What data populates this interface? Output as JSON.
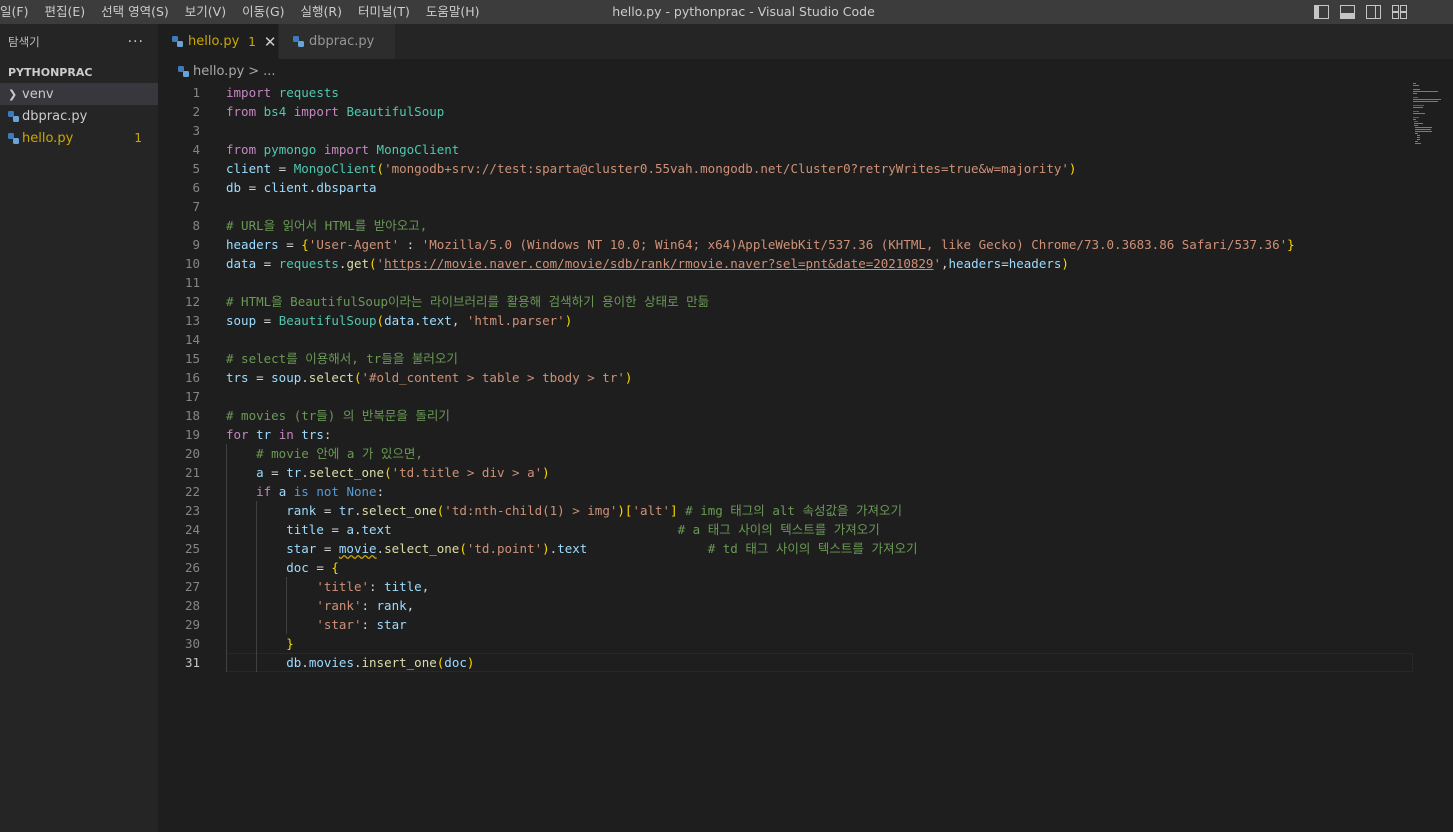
{
  "menu": [
    "일(F)",
    "편집(E)",
    "선택 영역(S)",
    "보기(V)",
    "이동(G)",
    "실행(R)",
    "터미널(T)",
    "도움말(H)"
  ],
  "window_title": "hello.py - pythonprac - Visual Studio Code",
  "sidebar": {
    "title": "탐색기",
    "more": "···",
    "section": "PYTHONPRAC",
    "items": [
      {
        "label": "venv",
        "type": "folder"
      },
      {
        "label": "dbprac.py",
        "type": "file"
      },
      {
        "label": "hello.py",
        "type": "file",
        "badge": "1"
      }
    ]
  },
  "tabs": [
    {
      "label": "hello.py",
      "modified": "1",
      "close": "✕"
    },
    {
      "label": "dbprac.py"
    }
  ],
  "breadcrumb": {
    "file": "hello.py",
    "sep": ">",
    "rest": "..."
  },
  "editor": {
    "line_numbers": [
      "1",
      "2",
      "3",
      "4",
      "5",
      "6",
      "7",
      "8",
      "9",
      "10",
      "11",
      "12",
      "13",
      "14",
      "15",
      "16",
      "17",
      "18",
      "19",
      "20",
      "21",
      "22",
      "23",
      "24",
      "25",
      "26",
      "27",
      "28",
      "29",
      "30",
      "31"
    ],
    "current_line": 31,
    "code": [
      "import requests",
      "from bs4 import BeautifulSoup",
      "",
      "from pymongo import MongoClient",
      "client = MongoClient('mongodb+srv://test:sparta@cluster0.55vah.mongodb.net/Cluster0?retryWrites=true&w=majority')",
      "db = client.dbsparta",
      "",
      "# URL을 읽어서 HTML를 받아오고,",
      "headers = {'User-Agent' : 'Mozilla/5.0 (Windows NT 10.0; Win64; x64)AppleWebKit/537.36 (KHTML, like Gecko) Chrome/73.0.3683.86 Safari/537.36'}",
      "data = requests.get('https://movie.naver.com/movie/sdb/rank/rmovie.naver?sel=pnt&date=20210829',headers=headers)",
      "",
      "# HTML을 BeautifulSoup이라는 라이브러리를 활용해 검색하기 용이한 상태로 만듦",
      "soup = BeautifulSoup(data.text, 'html.parser')",
      "",
      "# select를 이용해서, tr들을 불러오기",
      "trs = soup.select('#old_content > table > tbody > tr')",
      "",
      "# movies (tr들) 의 반복문을 돌리기",
      "for tr in trs:",
      "    # movie 안에 a 가 있으면,",
      "    a = tr.select_one('td.title > div > a')",
      "    if a is not None:",
      "        rank = tr.select_one('td:nth-child(1) > img')['alt'] # img 태그의 alt 속성값을 가져오기",
      "        title = a.text                                      # a 태그 사이의 텍스트를 가져오기",
      "        star = movie.select_one('td.point').text                # td 태그 사이의 텍스트를 가져오기",
      "        doc = {",
      "            'title': title,",
      "            'rank': rank,",
      "            'star': star",
      "        }",
      "        db.movies.insert_one(doc)"
    ]
  },
  "colors": {
    "keyword": "#569cd6",
    "control": "#c586c0",
    "function": "#dcdcaa",
    "class": "#4ec9b0",
    "string": "#ce9178",
    "comment": "#6a9955",
    "variable": "#9cdcfe",
    "warning": "#cca700"
  },
  "icons": {
    "python_file": "python-icon",
    "folder_chevron": "chevron-right-icon",
    "layout": [
      "toggle-sidebar-icon",
      "toggle-panel-icon",
      "toggle-secondary-sidebar-icon",
      "customize-layout-icon"
    ]
  }
}
